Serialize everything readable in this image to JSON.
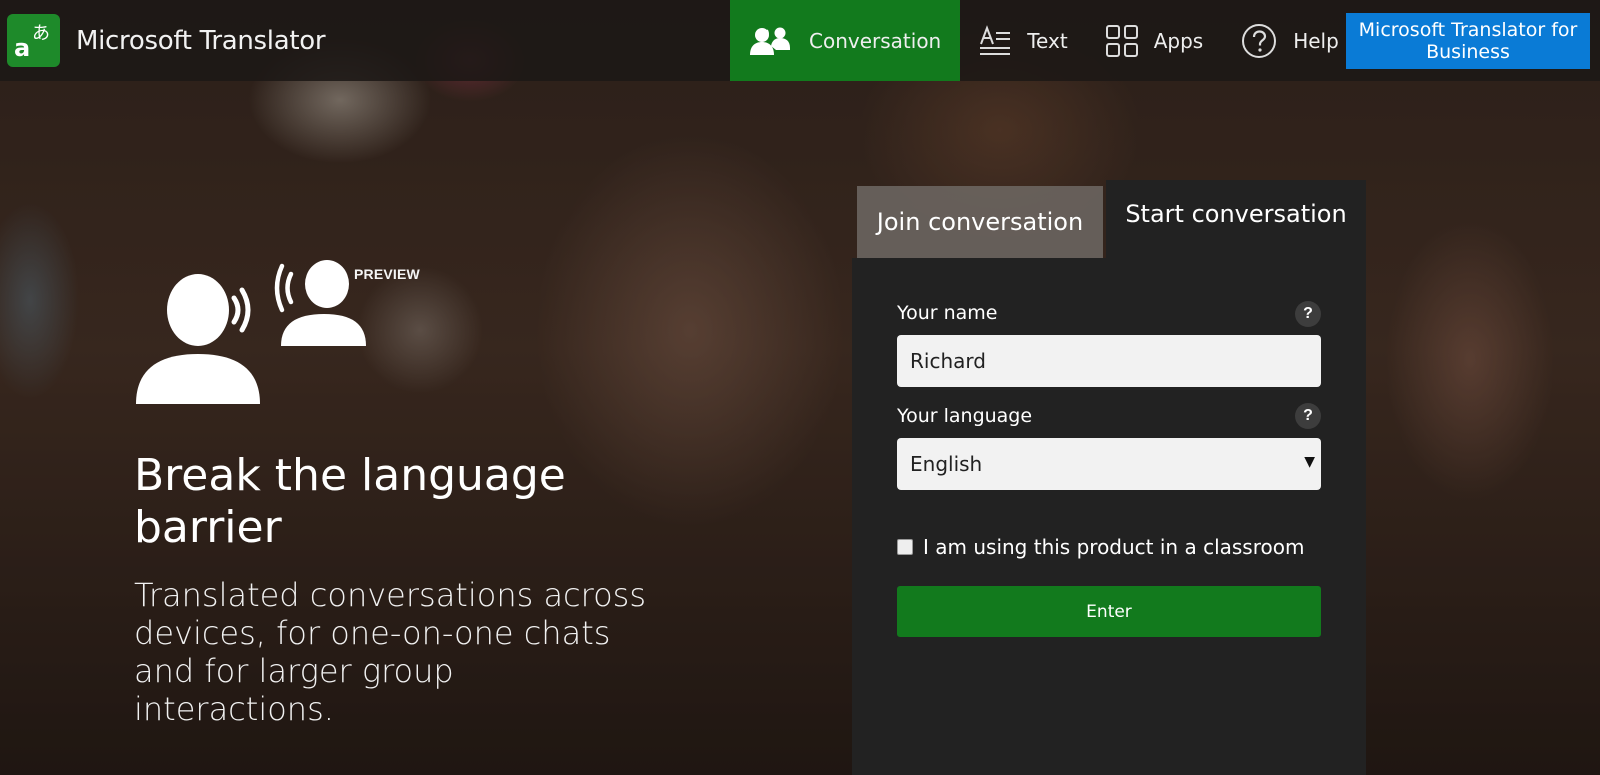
{
  "app": {
    "title": "Microsoft Translator",
    "logo_glyphs": [
      "a",
      "あ"
    ],
    "brand_color": "#1e8a2a"
  },
  "nav": {
    "items": [
      {
        "label": "Conversation",
        "icon": "people-icon",
        "active": true
      },
      {
        "label": "Text",
        "icon": "text-lines-icon",
        "active": false
      },
      {
        "label": "Apps",
        "icon": "apps-grid-icon",
        "active": false
      },
      {
        "label": "Help",
        "icon": "help-circle-icon",
        "active": false
      }
    ],
    "active_color": "#127a1d",
    "business_button": "Microsoft Translator for Business",
    "business_color": "#0a7bd6"
  },
  "hero": {
    "badge": "PREVIEW",
    "title": "Break the language barrier",
    "subtitle": "Translated conversations across devices, for one-on-one chats and for larger group interactions."
  },
  "panel": {
    "tabs": [
      {
        "label": "Join conversation",
        "active": false
      },
      {
        "label": "Start conversation",
        "active": true
      }
    ],
    "name_label": "Your name",
    "name_value": "Richard",
    "language_label": "Your language",
    "language_value": "English",
    "help_glyph": "?",
    "classroom_label": "I am using this product in a classroom",
    "classroom_checked": false,
    "enter_label": "Enter",
    "enter_color": "#127a1d"
  }
}
